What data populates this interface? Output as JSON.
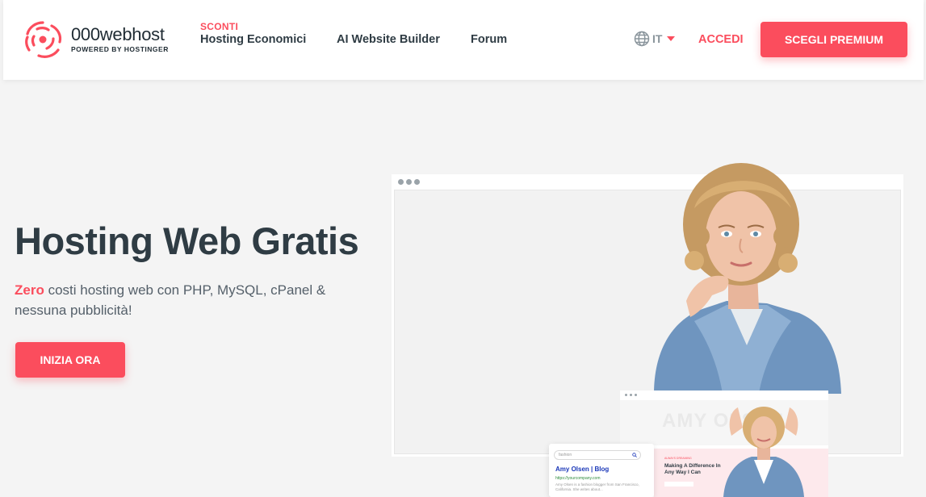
{
  "header": {
    "logo": {
      "name": "000webhost",
      "tagline": "POWERED BY HOSTINGER"
    },
    "nav": {
      "sconti_label": "SCONTI",
      "hosting": "Hosting Economici",
      "ai_builder": "AI Website Builder",
      "forum": "Forum"
    },
    "language": {
      "code": "IT",
      "icon": "globe-icon"
    },
    "login": "ACCEDI",
    "premium_button": "SCEGLI PREMIUM"
  },
  "hero": {
    "title": "Hosting Web Gratis",
    "subtitle_highlight": "Zero",
    "subtitle_rest": " costi hosting web con PHP, MySQL, cPanel & nessuna pubblicità!",
    "cta": "INIZIA ORA"
  },
  "illustration": {
    "mini_site_name": "AMY OLSEN",
    "mini_site_kicker": "ALWAYS DREAMING",
    "mini_site_headline": "Making A Difference In Any Way I Can",
    "search_query": "fashion",
    "search_result_title": "Amy Olsen | Blog",
    "search_result_url": "https://yourcompany.com",
    "search_result_desc": "Amy Olsen is a fashion blogger from San Francisco, California. She writes about..."
  },
  "colors": {
    "accent": "#fb4d5d",
    "text": "#2f3c44",
    "background": "#f4f4f4"
  }
}
